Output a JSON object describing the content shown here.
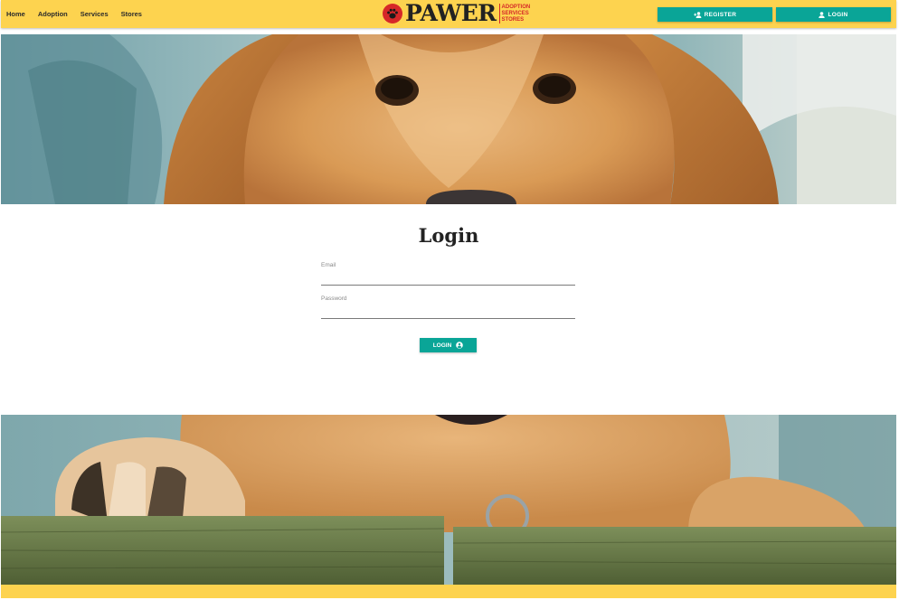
{
  "navbar": {
    "links": [
      "Home",
      "Adoption",
      "Services",
      "Stores"
    ],
    "brand": {
      "name": "PAWER",
      "taglines": [
        "ADOPTION",
        "SERVICES",
        "STORES"
      ],
      "icon": "paw-icon"
    },
    "register_label": "REGISTER",
    "login_label": "LOGIN",
    "register_icon": "person-add-icon",
    "login_icon": "person-icon"
  },
  "login_form": {
    "title": "Login",
    "email_label": "Email",
    "email_value": "",
    "password_label": "Password",
    "password_value": "",
    "submit_label": "LOGIN",
    "submit_icon": "account-circle-icon"
  },
  "hero": {
    "top_image": "golden-retriever-puppy-face",
    "bottom_image": "golden-retriever-puppy-paws-on-fence"
  },
  "colors": {
    "navbar": "#fdd34f",
    "accent": "#0aa597",
    "brand_red": "#d62828",
    "text": "#222222"
  }
}
